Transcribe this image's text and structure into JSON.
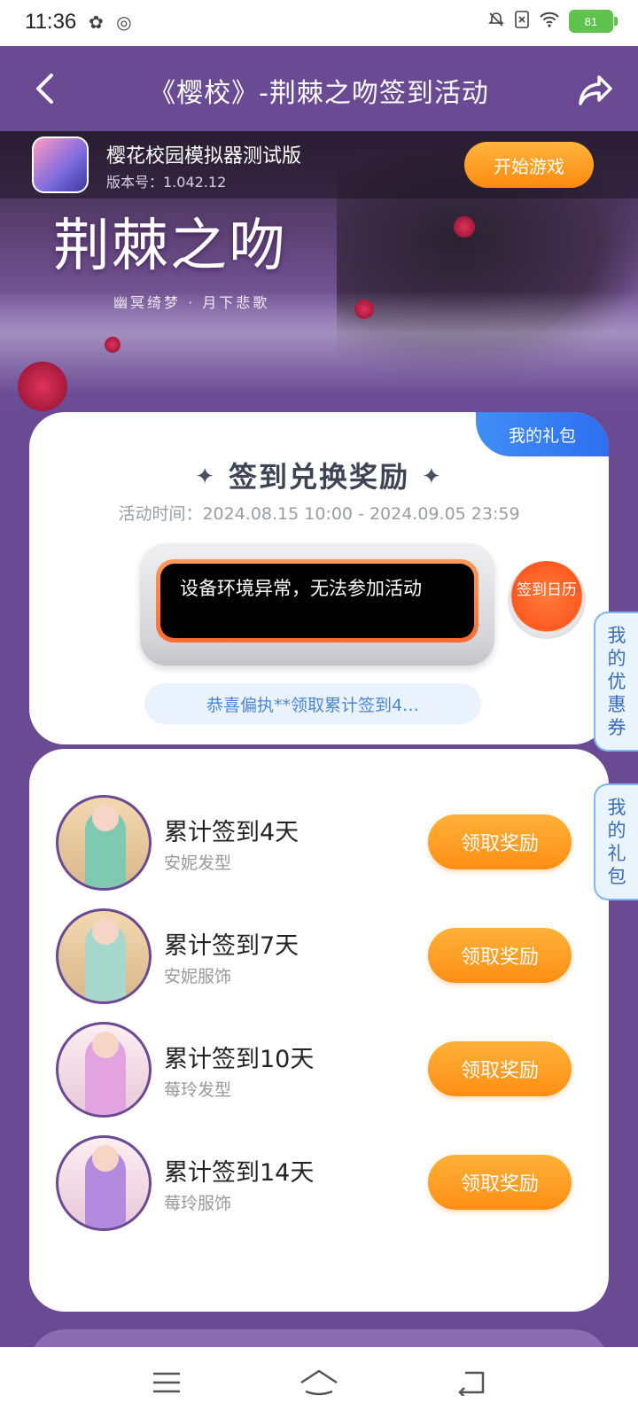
{
  "status_bar": {
    "time": "11:36",
    "app_icons": "✿ ◎",
    "battery": "81",
    "battery_color": "#5fc24c"
  },
  "header": {
    "title": "《樱校》-荆棘之吻签到活动",
    "back_icon": "chevron-left-icon",
    "share_icon": "share-icon",
    "background": "#6a4a93"
  },
  "game_bar": {
    "name": "樱花校园模拟器测试版",
    "version": "版本号：1.042.12",
    "start_label": "开始游戏"
  },
  "banner": {
    "title": "荆棘之吻",
    "subtitle": "幽冥绮梦 · 月下悲歌"
  },
  "signin_card": {
    "gift_tab": "我的礼包",
    "title": "签到兑换奖励",
    "event_time": "活动时间：2024.08.15 10:00 - 2024.09.05 23:59",
    "device_message": "设备环境异常，无法参加活动",
    "calendar_label": "签到日历",
    "marquee": "恭喜偏执**领取累计签到4…"
  },
  "rewards": [
    {
      "title": "累计签到4天",
      "item": "安妮发型",
      "button": "领取奖励"
    },
    {
      "title": "累计签到7天",
      "item": "安妮服饰",
      "button": "领取奖励"
    },
    {
      "title": "累计签到10天",
      "item": "莓玲发型",
      "button": "领取奖励"
    },
    {
      "title": "累计签到14天",
      "item": "莓玲服饰",
      "button": "领取奖励"
    }
  ],
  "side_tabs": {
    "coupons": "我的优惠券",
    "gifts": "我的礼包"
  },
  "colors": {
    "accent_orange": "#ff8e14",
    "accent_blue": "#2e6ff0",
    "purple": "#6a4a93"
  }
}
